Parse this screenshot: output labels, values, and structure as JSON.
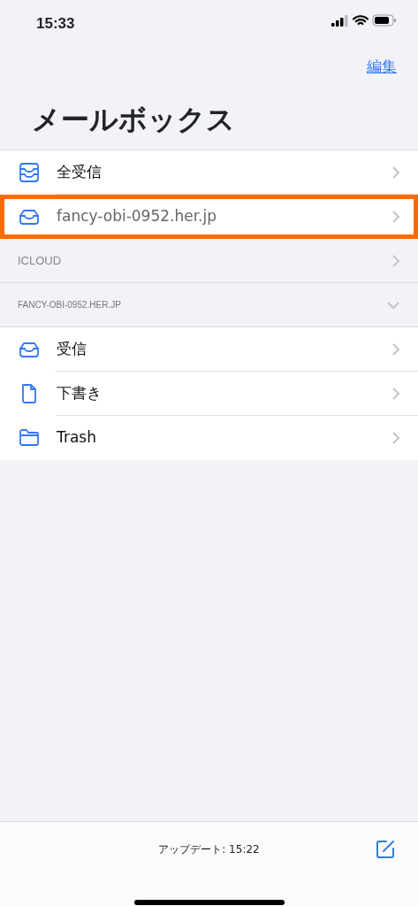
{
  "status_bar": {
    "time": "15:33"
  },
  "nav": {
    "edit": "編集",
    "title": "メールボックス"
  },
  "items": [
    {
      "kind": "mailbox",
      "label": "全受信",
      "highlighted": false
    },
    {
      "kind": "mailbox",
      "label": "fancy-obi-0952.her.jp",
      "highlighted": true
    },
    {
      "kind": "header",
      "label": "ICLOUD",
      "expanded": false
    },
    {
      "kind": "header",
      "label": "FANCY-OBI-0952.HER.JP",
      "expanded": true
    },
    {
      "kind": "mailbox",
      "label": "受信",
      "highlighted": false
    },
    {
      "kind": "mailbox",
      "label": "下書き",
      "highlighted": false
    },
    {
      "kind": "mailbox",
      "label": "Trash",
      "highlighted": false
    }
  ],
  "toolbar": {
    "status": "アップデート: 15:22"
  }
}
